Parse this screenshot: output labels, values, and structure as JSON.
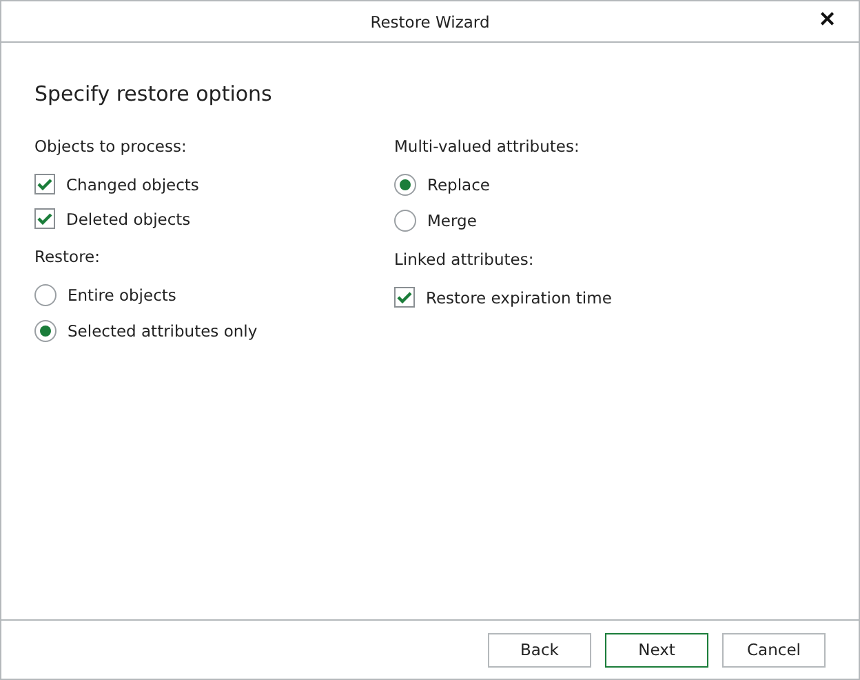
{
  "window": {
    "title": "Restore Wizard",
    "close": "✕"
  },
  "heading": "Specify restore options",
  "columns": [
    {
      "groups": [
        {
          "label": "Objects to process:",
          "options": [
            {
              "kind": "checkbox",
              "label": "Changed objects",
              "checked": true
            },
            {
              "kind": "checkbox",
              "label": "Deleted objects",
              "checked": true
            }
          ]
        },
        {
          "label": "Restore:",
          "options": [
            {
              "kind": "radio",
              "label": "Entire objects",
              "selected": false
            },
            {
              "kind": "radio",
              "label": "Selected attributes only",
              "selected": true
            }
          ]
        }
      ]
    },
    {
      "groups": [
        {
          "label": "Multi-valued attributes:",
          "options": [
            {
              "kind": "radio",
              "label": "Replace",
              "selected": true
            },
            {
              "kind": "radio",
              "label": "Merge",
              "selected": false
            }
          ]
        },
        {
          "label": "Linked attributes:",
          "options": [
            {
              "kind": "checkbox",
              "label": "Restore expiration time",
              "checked": true
            }
          ]
        }
      ]
    }
  ],
  "buttons": [
    {
      "label": "Back",
      "default": false
    },
    {
      "label": "Next",
      "default": true
    },
    {
      "label": "Cancel",
      "default": false
    }
  ]
}
